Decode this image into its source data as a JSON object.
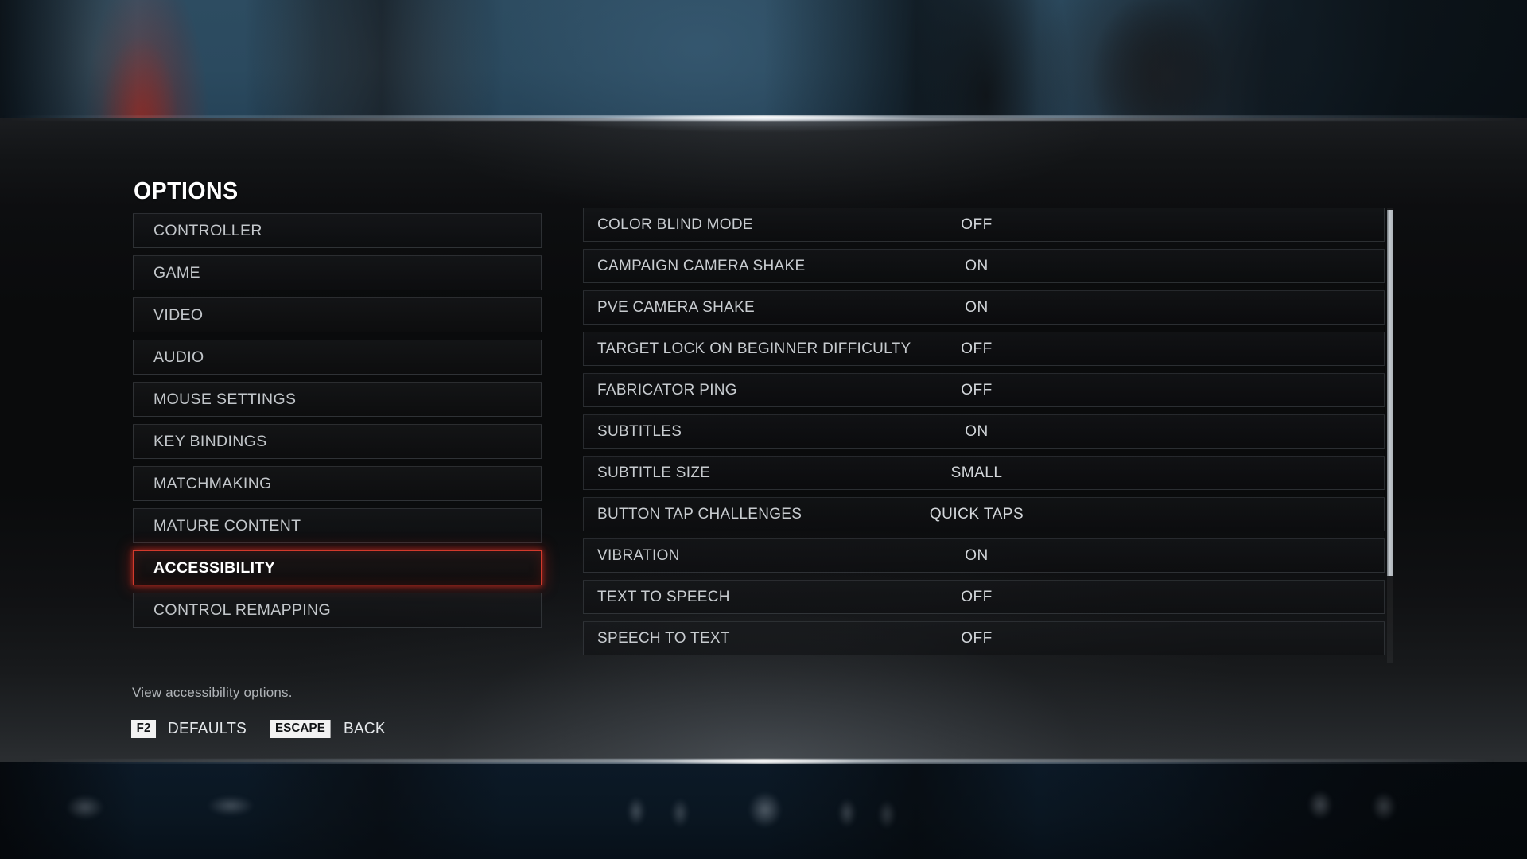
{
  "screen": {
    "title": "OPTIONS",
    "accent_color": "#d23a2c",
    "text_color": "#c8ccd0",
    "selected_text_color": "#ffffff"
  },
  "categories": {
    "items": [
      {
        "label": "CONTROLLER",
        "selected": false
      },
      {
        "label": "GAME",
        "selected": false
      },
      {
        "label": "VIDEO",
        "selected": false
      },
      {
        "label": "AUDIO",
        "selected": false
      },
      {
        "label": "MOUSE SETTINGS",
        "selected": false
      },
      {
        "label": "KEY BINDINGS",
        "selected": false
      },
      {
        "label": "MATCHMAKING",
        "selected": false
      },
      {
        "label": "MATURE CONTENT",
        "selected": false
      },
      {
        "label": "ACCESSIBILITY",
        "selected": true
      },
      {
        "label": "CONTROL REMAPPING",
        "selected": false
      }
    ]
  },
  "settings": {
    "rows": [
      {
        "label": "COLOR BLIND MODE",
        "value": "OFF"
      },
      {
        "label": "CAMPAIGN CAMERA SHAKE",
        "value": "ON"
      },
      {
        "label": "PVE CAMERA SHAKE",
        "value": "ON"
      },
      {
        "label": "TARGET LOCK ON BEGINNER DIFFICULTY",
        "value": "OFF"
      },
      {
        "label": "FABRICATOR PING",
        "value": "OFF"
      },
      {
        "label": "SUBTITLES",
        "value": "ON"
      },
      {
        "label": "SUBTITLE SIZE",
        "value": "SMALL"
      },
      {
        "label": "BUTTON TAP CHALLENGES",
        "value": "QUICK TAPS"
      },
      {
        "label": "VIBRATION",
        "value": "ON"
      },
      {
        "label": "TEXT TO SPEECH",
        "value": "OFF"
      },
      {
        "label": "SPEECH TO TEXT",
        "value": "OFF"
      }
    ]
  },
  "footer": {
    "description": "View accessibility options.",
    "hints": [
      {
        "key": "F2",
        "label": "DEFAULTS"
      },
      {
        "key": "ESCAPE",
        "label": "BACK"
      }
    ]
  }
}
